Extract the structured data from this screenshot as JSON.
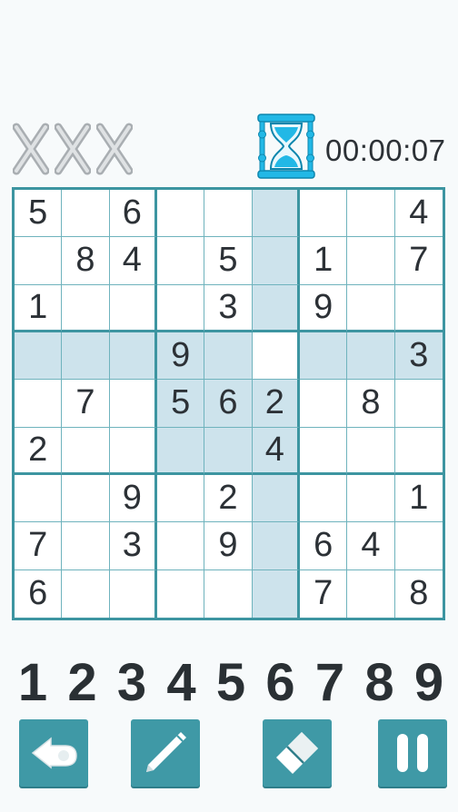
{
  "timer": "00:00:07",
  "mistakes": {
    "count": 3,
    "symbol": "X"
  },
  "board": [
    [
      "5",
      "",
      "6",
      "",
      "",
      "",
      "",
      "",
      "4"
    ],
    [
      "",
      "8",
      "4",
      "",
      "5",
      "",
      "1",
      "",
      "7"
    ],
    [
      "1",
      "",
      "",
      "",
      "3",
      "",
      "9",
      "",
      ""
    ],
    [
      "",
      "",
      "",
      "9",
      "",
      "",
      "",
      "",
      "3"
    ],
    [
      "",
      "7",
      "",
      "5",
      "6",
      "2",
      "",
      "8",
      ""
    ],
    [
      "2",
      "",
      "",
      "",
      "",
      "4",
      "",
      "",
      ""
    ],
    [
      "",
      "",
      "9",
      "",
      "2",
      "",
      "",
      "",
      "1"
    ],
    [
      "7",
      "",
      "3",
      "",
      "9",
      "",
      "6",
      "4",
      ""
    ],
    [
      "6",
      "",
      "",
      "",
      "",
      "",
      "7",
      "",
      "8"
    ]
  ],
  "selected": {
    "row": 3,
    "col": 5
  },
  "numpad": [
    "1",
    "2",
    "3",
    "4",
    "5",
    "6",
    "7",
    "8",
    "9"
  ],
  "tools": [
    {
      "name": "undo",
      "icon": "undo-arrow-icon"
    },
    {
      "name": "notes",
      "icon": "pencil-icon"
    },
    {
      "name": "erase",
      "icon": "eraser-icon"
    },
    {
      "name": "pause",
      "icon": "pause-icon"
    }
  ],
  "colors": {
    "accent": "#3f99a6",
    "highlight": "#cde3ec",
    "text": "#2c3136",
    "hourglass": "#22b8e6"
  }
}
